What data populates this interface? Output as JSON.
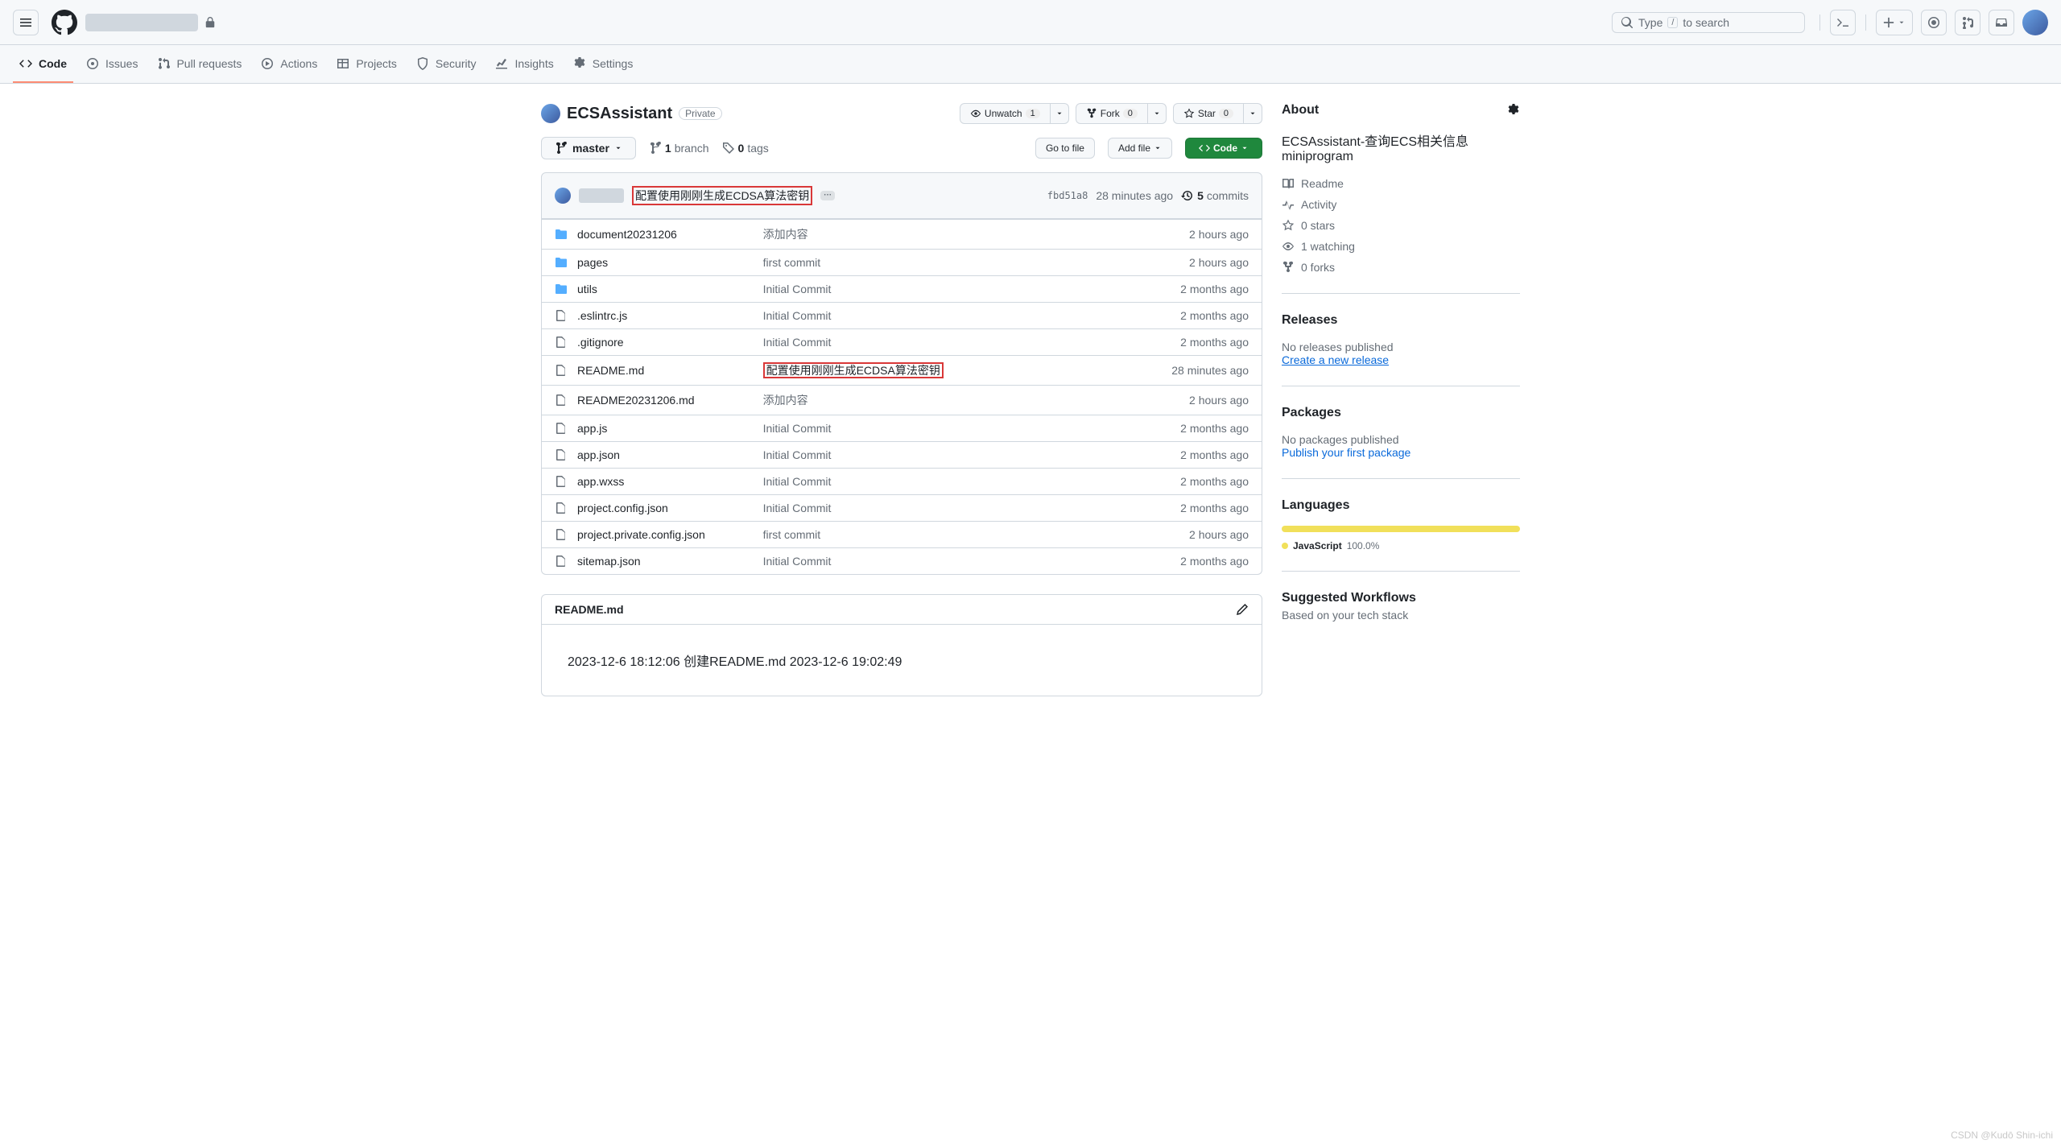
{
  "header": {
    "search_placeholder_a": "Type",
    "search_key": "/",
    "search_placeholder_b": "to search"
  },
  "nav": {
    "code": "Code",
    "issues": "Issues",
    "pulls": "Pull requests",
    "actions": "Actions",
    "projects": "Projects",
    "security": "Security",
    "insights": "Insights",
    "settings": "Settings"
  },
  "repo": {
    "name": "ECSAssistant",
    "visibility": "Private"
  },
  "actions": {
    "unwatch": "Unwatch",
    "unwatch_n": "1",
    "fork": "Fork",
    "fork_n": "0",
    "star": "Star",
    "star_n": "0"
  },
  "toolbar": {
    "branch": "master",
    "branches_n": "1",
    "branches_lbl": "branch",
    "tags_n": "0",
    "tags_lbl": "tags",
    "go_to_file": "Go to file",
    "add_file": "Add file",
    "code": "Code"
  },
  "commit": {
    "msg": "配置使用刚刚生成ECDSA算法密钥",
    "sha": "fbd51a8",
    "ago": "28 minutes ago",
    "commits_n": "5",
    "commits_lbl": "commits"
  },
  "files": [
    {
      "t": "dir",
      "name": "document20231206",
      "msg": "添加内容",
      "ago": "2 hours ago",
      "red": false
    },
    {
      "t": "dir",
      "name": "pages",
      "msg": "first commit",
      "ago": "2 hours ago",
      "red": false
    },
    {
      "t": "dir",
      "name": "utils",
      "msg": "Initial Commit",
      "ago": "2 months ago",
      "red": false
    },
    {
      "t": "file",
      "name": ".eslintrc.js",
      "msg": "Initial Commit",
      "ago": "2 months ago",
      "red": false
    },
    {
      "t": "file",
      "name": ".gitignore",
      "msg": "Initial Commit",
      "ago": "2 months ago",
      "red": false
    },
    {
      "t": "file",
      "name": "README.md",
      "msg": "配置使用刚刚生成ECDSA算法密钥",
      "ago": "28 minutes ago",
      "red": true
    },
    {
      "t": "file",
      "name": "README20231206.md",
      "msg": "添加内容",
      "ago": "2 hours ago",
      "red": false
    },
    {
      "t": "file",
      "name": "app.js",
      "msg": "Initial Commit",
      "ago": "2 months ago",
      "red": false
    },
    {
      "t": "file",
      "name": "app.json",
      "msg": "Initial Commit",
      "ago": "2 months ago",
      "red": false
    },
    {
      "t": "file",
      "name": "app.wxss",
      "msg": "Initial Commit",
      "ago": "2 months ago",
      "red": false
    },
    {
      "t": "file",
      "name": "project.config.json",
      "msg": "Initial Commit",
      "ago": "2 months ago",
      "red": false
    },
    {
      "t": "file",
      "name": "project.private.config.json",
      "msg": "first commit",
      "ago": "2 hours ago",
      "red": false
    },
    {
      "t": "file",
      "name": "sitemap.json",
      "msg": "Initial Commit",
      "ago": "2 months ago",
      "red": false
    }
  ],
  "readme": {
    "title": "README.md",
    "body": "2023-12-6 18:12:06 创建README.md 2023-12-6 19:02:49"
  },
  "about": {
    "title": "About",
    "desc": "ECSAssistant-查询ECS相关信息miniprogram",
    "readme": "Readme",
    "activity": "Activity",
    "stars": "0 stars",
    "watching": "1 watching",
    "forks": "0 forks"
  },
  "releases": {
    "title": "Releases",
    "none": "No releases published",
    "create": "Create a new release"
  },
  "packages": {
    "title": "Packages",
    "none": "No packages published",
    "publish": "Publish your first package"
  },
  "languages": {
    "title": "Languages",
    "name": "JavaScript",
    "pct": "100.0%"
  },
  "workflows": {
    "title": "Suggested Workflows",
    "sub": "Based on your tech stack"
  },
  "watermark": "CSDN @Kudō Shin-ichi"
}
